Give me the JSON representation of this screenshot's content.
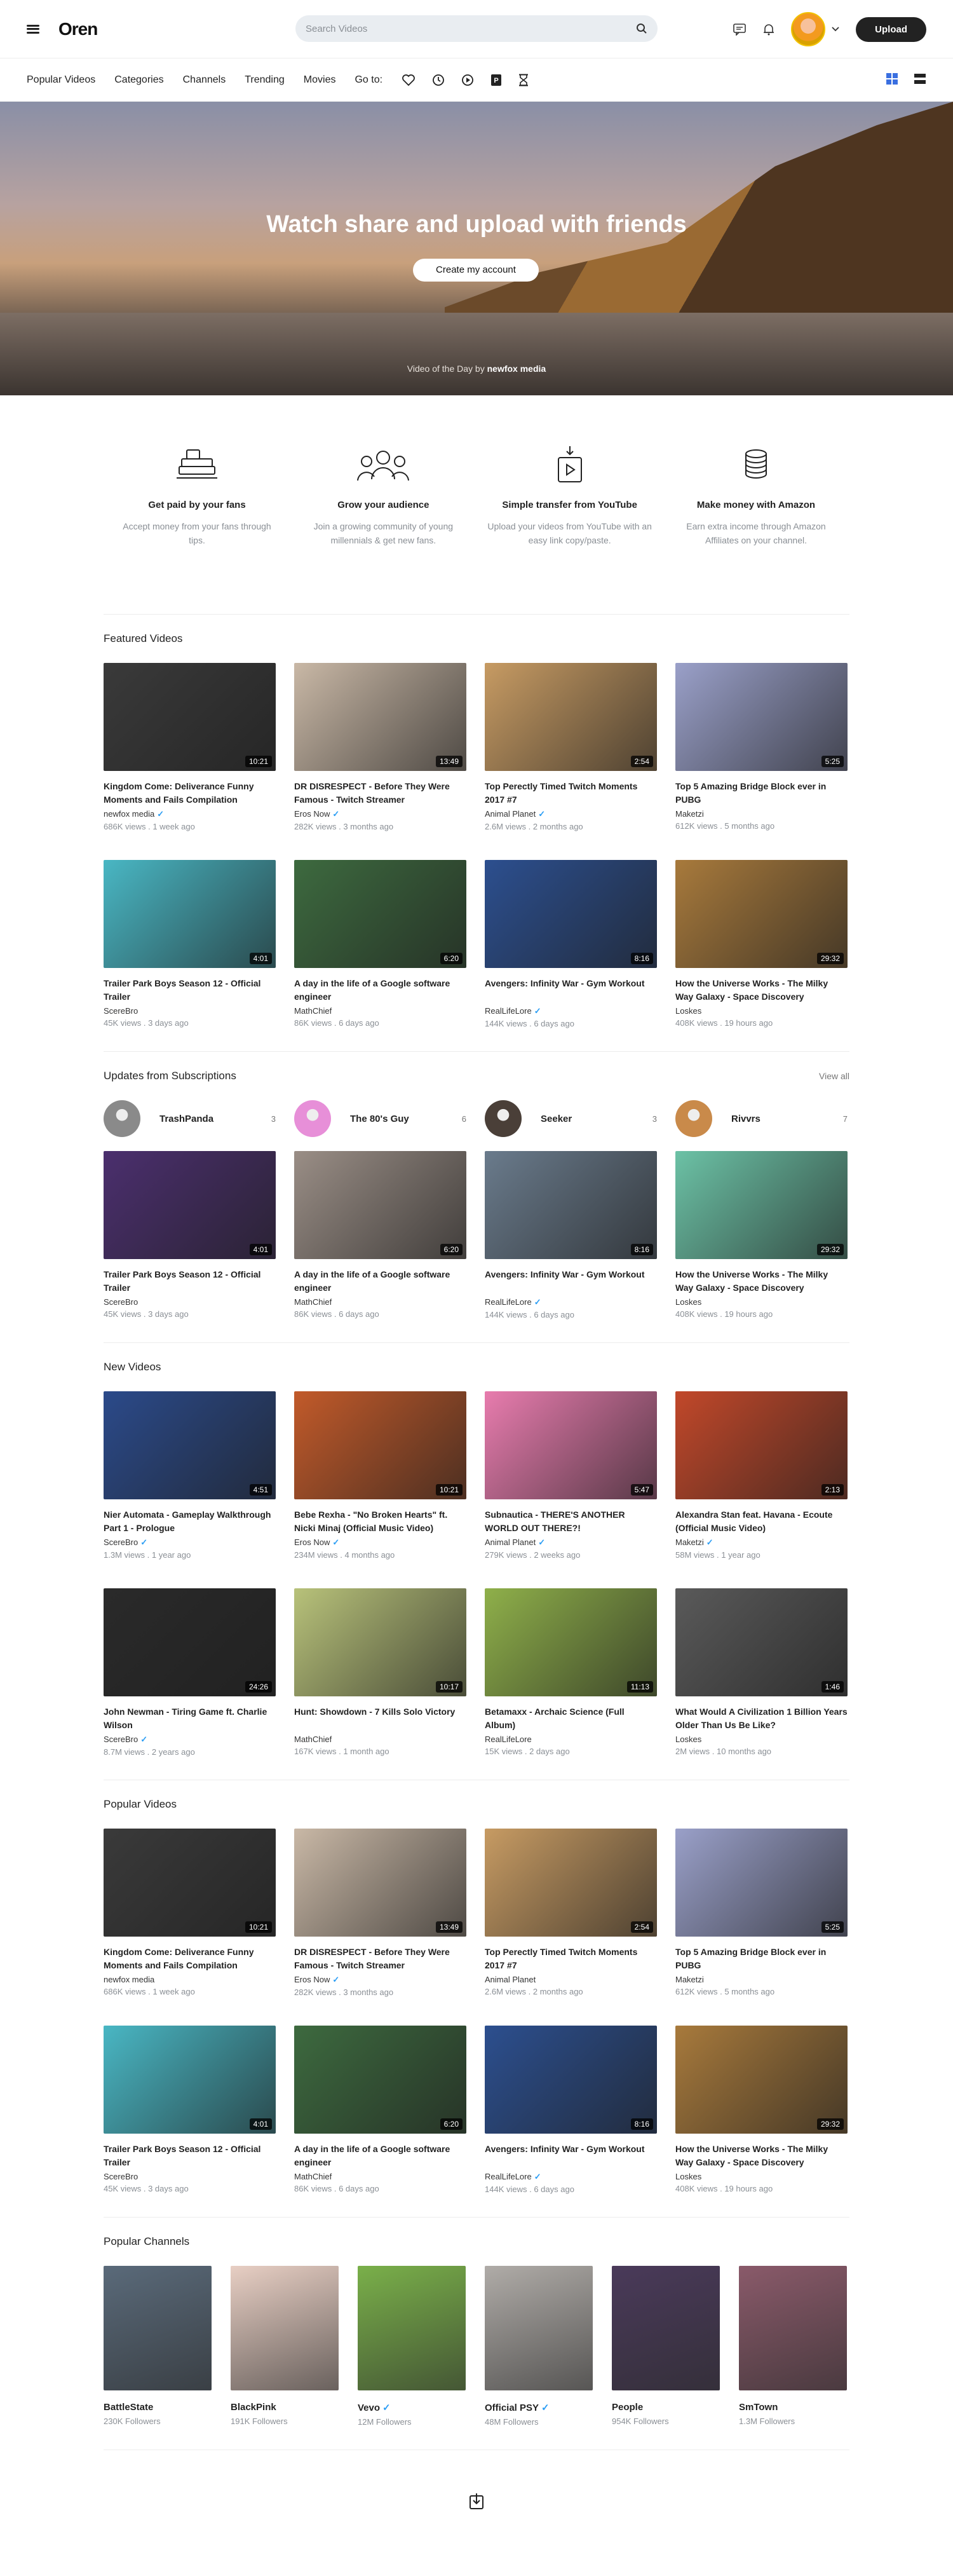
{
  "header": {
    "logo": "Oren",
    "search_placeholder": "Search Videos",
    "upload_label": "Upload"
  },
  "nav": {
    "items": [
      "Popular Videos",
      "Categories",
      "Channels",
      "Trending",
      "Movies",
      "Go to:"
    ]
  },
  "hero": {
    "title": "Watch share and upload with friends",
    "cta": "Create my account",
    "vod_prefix": "Video of the Day by",
    "vod_channel": "newfox media"
  },
  "features": [
    {
      "title": "Get paid by your fans",
      "text": "Accept money from your fans through tips."
    },
    {
      "title": "Grow your audience",
      "text": "Join a growing community of young millennials & get new fans."
    },
    {
      "title": "Simple transfer from YouTube",
      "text": "Upload your videos from YouTube with an easy link copy/paste."
    },
    {
      "title": "Make money with Amazon",
      "text": "Earn extra income through Amazon Affiliates on your channel."
    }
  ],
  "featured": {
    "heading": "Featured Videos",
    "videos": [
      {
        "title": "Kingdom Come: Deliverance Funny Moments and Fails Compilation",
        "channel": "newfox media",
        "verified": true,
        "views": "686K views",
        "age": "1 week ago",
        "duration": "10:21",
        "color": "#3a3a3a"
      },
      {
        "title": "DR DISRESPECT - Before They Were Famous - Twitch Streamer",
        "channel": "Eros Now",
        "verified": true,
        "views": "282K views",
        "age": "3 months ago",
        "duration": "13:49",
        "color": "#c9b8a6"
      },
      {
        "title": "Top Perectly Timed Twitch Moments 2017 #7",
        "channel": "Animal Planet",
        "verified": true,
        "views": "2.6M views",
        "age": "2 months ago",
        "duration": "2:54",
        "color": "#c79b63"
      },
      {
        "title": "Top 5 Amazing Bridge Block ever in PUBG",
        "channel": "Maketzi",
        "verified": false,
        "views": "612K views",
        "age": "5 months ago",
        "duration": "5:25",
        "color": "#9aa0c9"
      },
      {
        "title": "Trailer Park Boys Season 12 - Official Trailer",
        "channel": "ScereBro",
        "verified": false,
        "views": "45K views",
        "age": "3 days ago",
        "duration": "4:01",
        "color": "#49b7c4"
      },
      {
        "title": "A day in the life of a Google software engineer",
        "channel": "MathChief",
        "verified": false,
        "views": "86K views",
        "age": "6 days ago",
        "duration": "6:20",
        "color": "#3d6a3f"
      },
      {
        "title": "Avengers: Infinity War - Gym Workout",
        "channel": "RealLifeLore",
        "verified": true,
        "views": "144K views",
        "age": "6 days ago",
        "duration": "8:16",
        "color": "#2c4f8f"
      },
      {
        "title": "How the Universe Works - The Milky Way Galaxy - Space Discovery",
        "channel": "Loskes",
        "verified": false,
        "views": "408K views",
        "age": "19 hours ago",
        "duration": "29:32",
        "color": "#a87a3c"
      }
    ]
  },
  "subscriptions": {
    "heading": "Updates from Subscriptions",
    "view_all": "View all",
    "channels": [
      {
        "name": "TrashPanda",
        "count": "3",
        "color": "#8a8a8a"
      },
      {
        "name": "The 80's Guy",
        "count": "6",
        "color": "#e78fd8"
      },
      {
        "name": "Seeker",
        "count": "3",
        "color": "#4a3f38"
      },
      {
        "name": "Rivvrs",
        "count": "7",
        "color": "#c98a4a"
      }
    ],
    "videos": [
      {
        "title": "Trailer Park Boys Season 12 - Official Trailer",
        "channel": "ScereBro",
        "verified": false,
        "views": "45K views",
        "age": "3 days ago",
        "duration": "4:01",
        "color": "#4b2f6e"
      },
      {
        "title": "A day in the life of a Google software engineer",
        "channel": "MathChief",
        "verified": false,
        "views": "86K views",
        "age": "6 days ago",
        "duration": "6:20",
        "color": "#9a8e86"
      },
      {
        "title": "Avengers: Infinity War - Gym Workout",
        "channel": "RealLifeLore",
        "verified": true,
        "views": "144K views",
        "age": "6 days ago",
        "duration": "8:16",
        "color": "#6a7b8c"
      },
      {
        "title": "How the Universe Works - The Milky Way Galaxy - Space Discovery",
        "channel": "Loskes",
        "verified": false,
        "views": "408K views",
        "age": "19 hours ago",
        "duration": "29:32",
        "color": "#6cc2a6"
      }
    ]
  },
  "new_videos": {
    "heading": "New Videos",
    "videos": [
      {
        "title": "Nier Automata - Gameplay Walkthrough Part 1 - Prologue",
        "channel": "ScereBro",
        "verified": true,
        "views": "1.3M views",
        "age": "1 year ago",
        "duration": "4:51",
        "color": "#2b4a8a"
      },
      {
        "title": "Bebe Rexha - \"No Broken Hearts\" ft. Nicki Minaj (Official Music Video)",
        "channel": "Eros Now",
        "verified": true,
        "views": "234M views",
        "age": "4 months ago",
        "duration": "10:21",
        "color": "#c25a2a"
      },
      {
        "title": "Subnautica - THERE'S ANOTHER WORLD OUT THERE?!",
        "channel": "Animal Planet",
        "verified": true,
        "views": "279K views",
        "age": "2 weeks ago",
        "duration": "5:47",
        "color": "#e87cae"
      },
      {
        "title": "Alexandra Stan feat. Havana - Ecoute (Official Music Video)",
        "channel": "Maketzi",
        "verified": true,
        "views": "58M views",
        "age": "1 year ago",
        "duration": "2:13",
        "color": "#c2482a"
      },
      {
        "title": "John Newman - Tiring Game ft. Charlie Wilson",
        "channel": "ScereBro",
        "verified": true,
        "views": "8.7M views",
        "age": "2 years ago",
        "duration": "24:26",
        "color": "#2a2a2a"
      },
      {
        "title": "Hunt: Showdown - 7 Kills Solo Victory",
        "channel": "MathChief",
        "verified": false,
        "views": "167K views",
        "age": "1 month ago",
        "duration": "10:17",
        "color": "#b8c27a"
      },
      {
        "title": "Betamaxx - Archaic Science (Full Album)",
        "channel": "RealLifeLore",
        "verified": false,
        "views": "15K views",
        "age": "2 days ago",
        "duration": "11:13",
        "color": "#8fb04a"
      },
      {
        "title": "What Would A Civilization 1 Billion Years Older Than Us Be Like?",
        "channel": "Loskes",
        "verified": false,
        "views": "2M views",
        "age": "10 months ago",
        "duration": "1:46",
        "color": "#5a5a5a"
      }
    ]
  },
  "popular": {
    "heading": "Popular Videos",
    "videos": [
      {
        "title": "Kingdom Come: Deliverance Funny Moments and Fails Compilation",
        "channel": "newfox media",
        "verified": false,
        "views": "686K views",
        "age": "1 week ago",
        "duration": "10:21",
        "color": "#3a3a3a"
      },
      {
        "title": "DR DISRESPECT - Before They Were Famous - Twitch Streamer",
        "channel": "Eros Now",
        "verified": true,
        "views": "282K views",
        "age": "3 months ago",
        "duration": "13:49",
        "color": "#c9b8a6"
      },
      {
        "title": "Top Perectly Timed Twitch Moments 2017 #7",
        "channel": "Animal Planet",
        "verified": false,
        "views": "2.6M views",
        "age": "2 months ago",
        "duration": "2:54",
        "color": "#c79b63"
      },
      {
        "title": "Top 5 Amazing Bridge Block ever in PUBG",
        "channel": "Maketzi",
        "verified": false,
        "views": "612K views",
        "age": "5 months ago",
        "duration": "5:25",
        "color": "#9aa0c9"
      },
      {
        "title": "Trailer Park Boys Season 12 - Official Trailer",
        "channel": "ScereBro",
        "verified": false,
        "views": "45K views",
        "age": "3 days ago",
        "duration": "4:01",
        "color": "#49b7c4"
      },
      {
        "title": "A day in the life of a Google software engineer",
        "channel": "MathChief",
        "verified": false,
        "views": "86K views",
        "age": "6 days ago",
        "duration": "6:20",
        "color": "#3d6a3f"
      },
      {
        "title": "Avengers: Infinity War - Gym Workout",
        "channel": "RealLifeLore",
        "verified": true,
        "views": "144K views",
        "age": "6 days ago",
        "duration": "8:16",
        "color": "#2c4f8f"
      },
      {
        "title": "How the Universe Works - The Milky Way Galaxy - Space Discovery",
        "channel": "Loskes",
        "verified": false,
        "views": "408K views",
        "age": "19 hours ago",
        "duration": "29:32",
        "color": "#a87a3c"
      }
    ]
  },
  "popular_channels": {
    "heading": "Popular Channels",
    "channels": [
      {
        "name": "BattleState",
        "followers": "230K Followers",
        "verified": false,
        "color": "#5a6a7a"
      },
      {
        "name": "BlackPink",
        "followers": "191K Followers",
        "verified": false,
        "color": "#e8cfc4"
      },
      {
        "name": "Vevo",
        "followers": "12M Followers",
        "verified": true,
        "color": "#7ab04a"
      },
      {
        "name": "Official PSY",
        "followers": "48M Followers",
        "verified": true,
        "color": "#b0aca8"
      },
      {
        "name": "People",
        "followers": "954K Followers",
        "verified": false,
        "color": "#4a3a5a"
      },
      {
        "name": "SmTown",
        "followers": "1.3M Followers",
        "verified": false,
        "color": "#8a5a6a"
      }
    ]
  }
}
